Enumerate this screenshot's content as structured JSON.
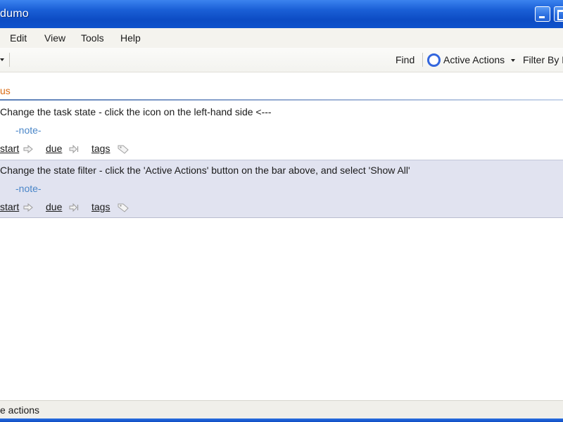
{
  "window": {
    "title": "dumo"
  },
  "menu": {
    "items": [
      "Edit",
      "View",
      "Tools",
      "Help"
    ]
  },
  "toolbar": {
    "find_label": "Find",
    "active_actions_label": "Active Actions",
    "filter_label": "Filter By D"
  },
  "section": {
    "title": "us"
  },
  "tasks": [
    {
      "name": "Change the task state - click the icon on the left-hand side <---",
      "note": "-note-",
      "start": "start",
      "due": "due",
      "tags": "tags"
    },
    {
      "name": "Change the state filter - click the 'Active Actions' button on the bar above, and select 'Show All'",
      "note": "-note-",
      "start": "start",
      "due": "due",
      "tags": "tags"
    }
  ],
  "status": {
    "text": "e actions"
  },
  "icons": {
    "start": "arrow-right-icon",
    "due": "due-arrow-icon",
    "tags": "tag-icon",
    "active_actions": "ring-icon"
  },
  "colors": {
    "title_bar": "#0f52cc",
    "section_title": "#d96a12",
    "note_text": "#4a86c8",
    "selected_row": "#e1e3f0"
  }
}
